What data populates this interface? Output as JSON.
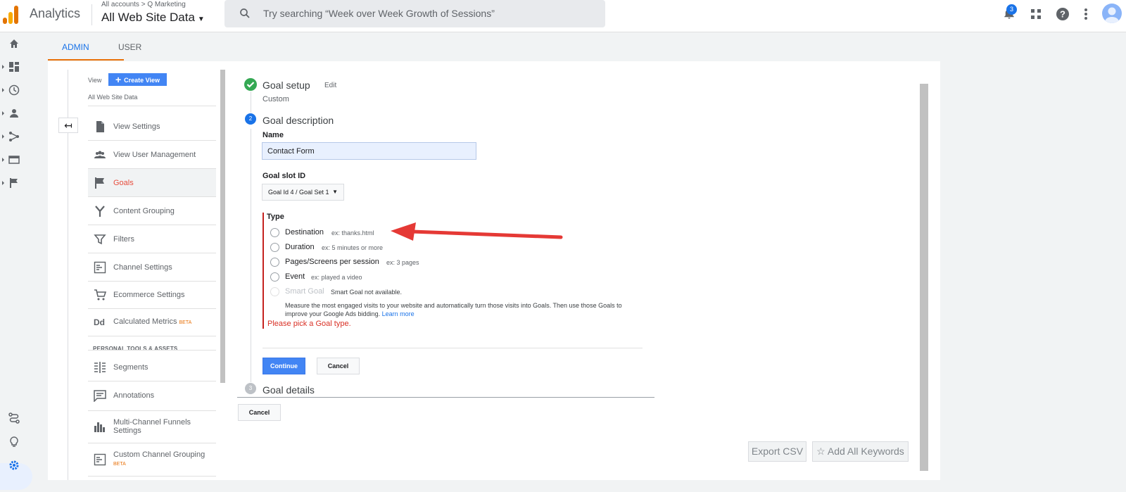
{
  "header": {
    "app_name": "Analytics",
    "breadcrumb_accounts": "All accounts",
    "breadcrumb_account": "Q Marketing",
    "property": "All Web Site Data",
    "search_placeholder": "Try searching “Week over Week Growth of Sessions”",
    "notification_count": "3",
    "icons": [
      "bell-icon",
      "apps-grid-icon",
      "help-icon",
      "more-vert-icon",
      "account-avatar"
    ]
  },
  "tabs": [
    {
      "label": "ADMIN",
      "active": true
    },
    {
      "label": "USER",
      "active": false
    }
  ],
  "view_panel": {
    "view_label": "View",
    "create_view": "Create View",
    "view_name": "All Web Site Data",
    "nav": [
      {
        "label": "View Settings",
        "icon": "document-icon"
      },
      {
        "label": "View User Management",
        "icon": "people-icon"
      },
      {
        "label": "Goals",
        "icon": "flag-icon",
        "active": true
      },
      {
        "label": "Content Grouping",
        "icon": "grouping-icon"
      },
      {
        "label": "Filters",
        "icon": "filter-icon"
      },
      {
        "label": "Channel Settings",
        "icon": "channel-icon"
      },
      {
        "label": "Ecommerce Settings",
        "icon": "cart-icon"
      },
      {
        "label": "Calculated Metrics",
        "icon": "dd-icon",
        "badge": "BETA"
      }
    ],
    "section_title": "PERSONAL TOOLS & ASSETS",
    "personal": [
      {
        "label": "Segments",
        "icon": "segments-icon"
      },
      {
        "label": "Annotations",
        "icon": "comment-icon"
      },
      {
        "label": "Multi-Channel Funnels Settings",
        "icon": "bar-chart-icon"
      },
      {
        "label": "Custom Channel Grouping",
        "icon": "channel-icon",
        "badge": "BETA"
      }
    ]
  },
  "goal_form": {
    "step1": {
      "title": "Goal setup",
      "edit": "Edit",
      "sub": "Custom"
    },
    "step2": {
      "num": "2",
      "title": "Goal description"
    },
    "name_label": "Name",
    "name_value": "Contact Form",
    "slot_label": "Goal slot ID",
    "slot_value": "Goal Id 4 / Goal Set 1",
    "type_label": "Type",
    "types": [
      {
        "label": "Destination",
        "example": "ex: thanks.html"
      },
      {
        "label": "Duration",
        "example": "ex: 5 minutes or more"
      },
      {
        "label": "Pages/Screens per session",
        "example": "ex: 3 pages"
      },
      {
        "label": "Event",
        "example": "ex: played a video"
      },
      {
        "label": "Smart Goal",
        "example": "Smart Goal not available.",
        "disabled": true
      }
    ],
    "smart_desc": "Measure the most engaged visits to your website and automatically turn those visits into Goals. Then use those Goals to improve your Google Ads bidding.",
    "learn_more": "Learn more",
    "error": "Please pick a Goal type.",
    "continue": "Continue",
    "cancel": "Cancel",
    "step3": {
      "num": "3",
      "title": "Goal details"
    },
    "cancel_bottom": "Cancel"
  },
  "bottom_buttons": {
    "export": "Export CSV",
    "add_keywords": "Add All Keywords"
  },
  "colors": {
    "accent": "#1a73e8",
    "primary_button": "#4285f4",
    "error": "#c5221f",
    "annotation_arrow": "#e53935",
    "complete_step": "#34a853"
  }
}
